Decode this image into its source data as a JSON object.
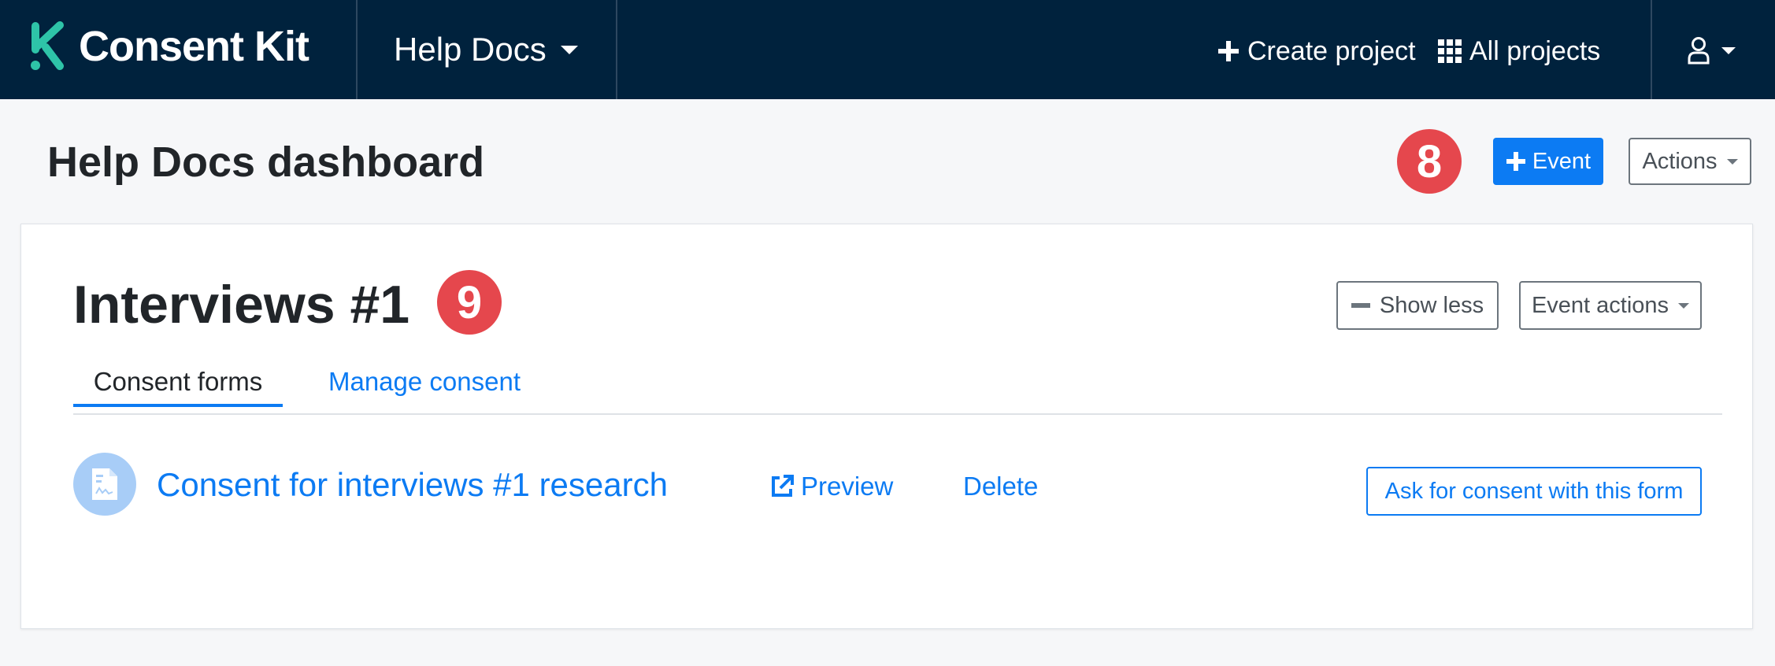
{
  "topbar": {
    "brand": "Consent Kit",
    "project_name": "Help Docs",
    "create_project": "Create project",
    "all_projects": "All projects"
  },
  "dashboard": {
    "title": "Help Docs dashboard",
    "badge_step": "8",
    "add_event_label": "Event",
    "actions_label": "Actions"
  },
  "event": {
    "title": "Interviews #1",
    "badge_step": "9",
    "show_less_label": "Show less",
    "event_actions_label": "Event actions",
    "tabs": [
      {
        "label": "Consent forms",
        "active": true
      },
      {
        "label": "Manage consent",
        "active": false
      }
    ],
    "forms": [
      {
        "title": "Consent for interviews #1 research",
        "preview_label": "Preview",
        "delete_label": "Delete",
        "ask_label": "Ask for consent with this form"
      }
    ]
  },
  "colors": {
    "topbar_bg": "#00223d",
    "primary": "#0c7bf3",
    "badge": "#e5474d",
    "brand_teal": "#2ec4a8"
  },
  "icons": {
    "brand_logo": "k-logo-icon",
    "project_caret": "chevron-down-icon",
    "create": "plus-icon",
    "all_projects": "grid-icon",
    "user": "user-icon",
    "show_less": "minus-icon",
    "form": "document-icon",
    "preview": "external-link-icon"
  }
}
